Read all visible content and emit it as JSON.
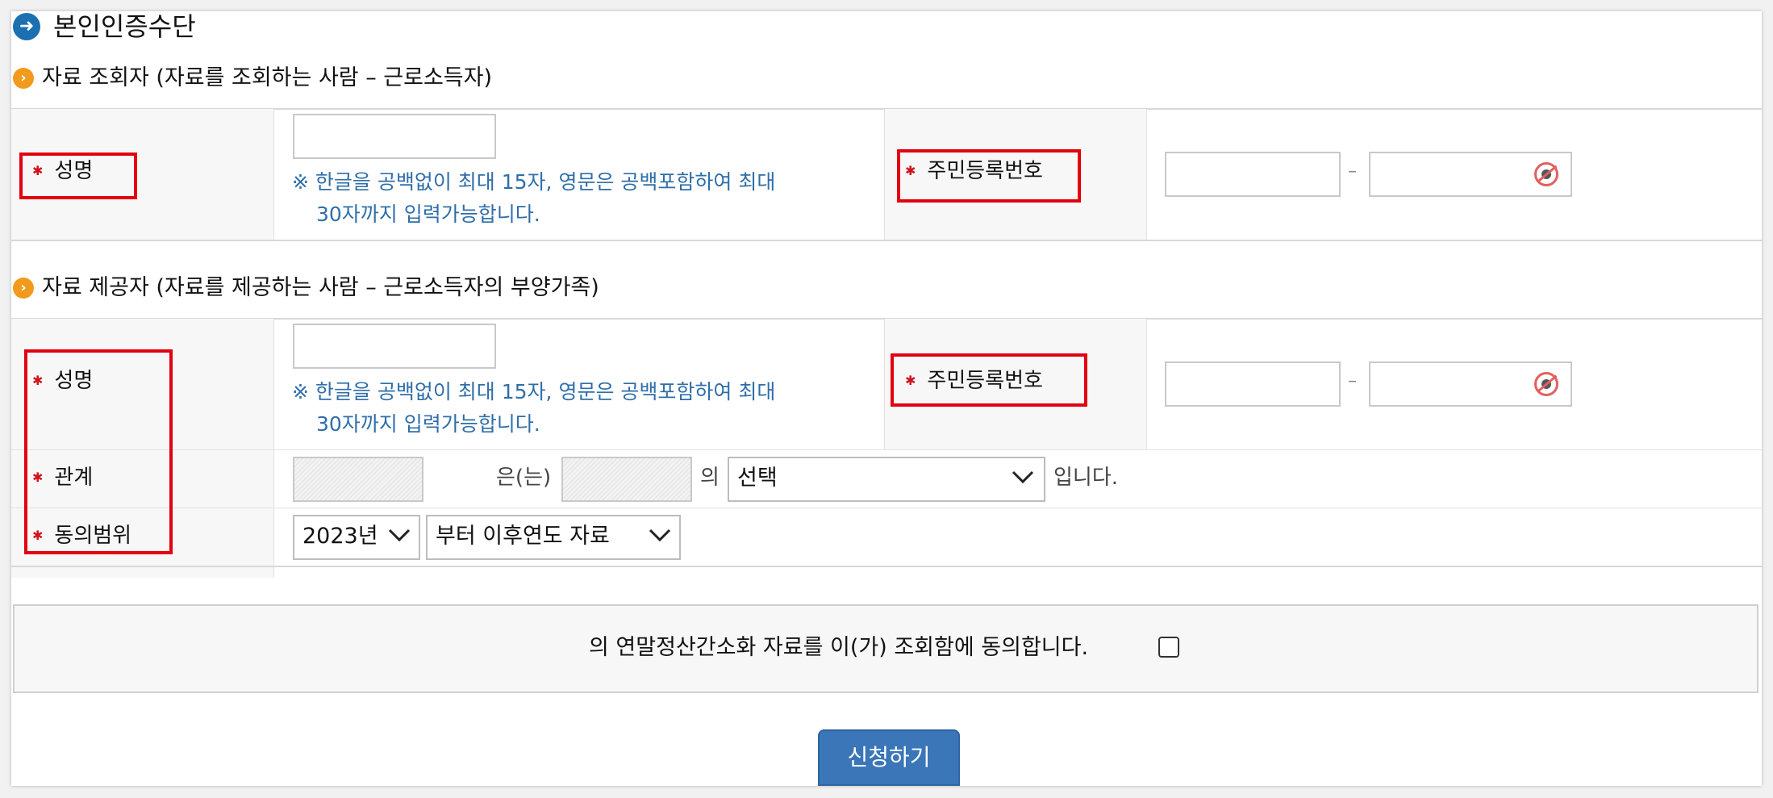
{
  "header": {
    "title": "본인인증수단",
    "title_icon": "arrow-right-circle-icon"
  },
  "viewer_section": {
    "title": "자료 조회자 (자료를 조회하는 사람 – 근로소득자)",
    "icon": "chevron-right-circle-icon",
    "name_label": "성명",
    "name_hint_line1": "※ 한글을 공백없이 최대 15자, 영문은 공백포함하여 최대",
    "name_hint_line2": "30자까지 입력가능합니다.",
    "rrn_label": "주민등록번호",
    "rrn_separator": "–",
    "name_value": "",
    "rrn_front_value": "",
    "rrn_back_value": ""
  },
  "provider_section": {
    "title": "자료 제공자 (자료를 제공하는 사람 – 근로소득자의 부양가족)",
    "icon": "chevron-right-circle-icon",
    "name_label": "성명",
    "name_hint_line1": "※ 한글을 공백없이 최대 15자, 영문은 공백포함하여 최대",
    "name_hint_line2": "30자까지 입력가능합니다.",
    "rrn_label": "주민등록번호",
    "rrn_separator": "–",
    "relation_label": "관계",
    "relation_connector1": "은(는)",
    "relation_connector2": "의",
    "relation_select": "선택",
    "relation_suffix": "입니다.",
    "scope_label": "동의범위",
    "scope_year": "2023년",
    "scope_option": "부터 이후연도 자료"
  },
  "consent": {
    "text": "의 연말정산간소화 자료를 이(가) 조회함에 동의합니다.",
    "checked": false
  },
  "submit_label": "신청하기",
  "colors": {
    "required_star": "#d0121b",
    "hint_text": "#2f6ea9",
    "highlight_box": "#e3000f",
    "button_bg": "#3a76b8",
    "section_icon": "#f29a1d",
    "title_icon": "#1c6fb0"
  }
}
